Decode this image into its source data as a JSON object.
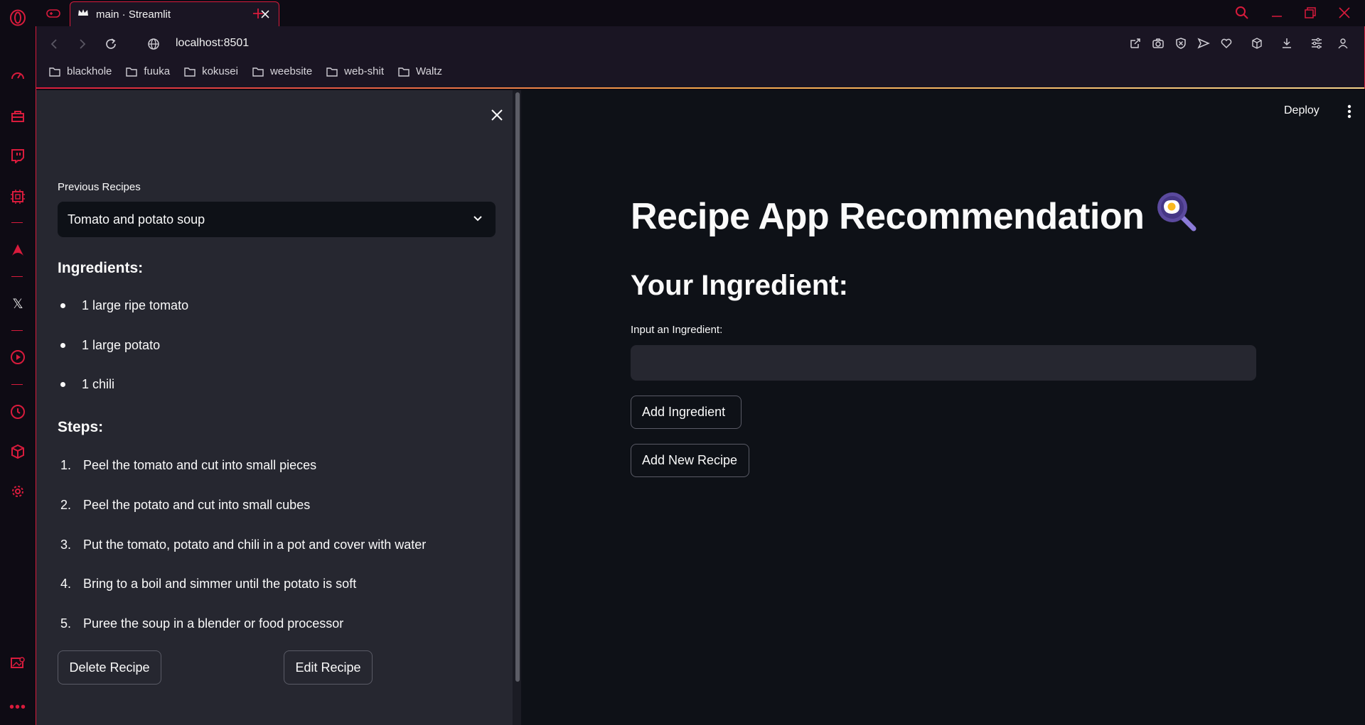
{
  "browser": {
    "tab_title": "main · Streamlit",
    "url": "localhost:8501",
    "bookmarks": [
      "blackhole",
      "fuuka",
      "kokusei",
      "weebsite",
      "web-shit",
      "Waltz"
    ],
    "accent": "#d81b3c"
  },
  "rail_icons": [
    "opera-logo-icon",
    "speed-dial-icon",
    "shopping-bag-icon",
    "twitch-icon",
    "ai-chip-icon",
    "aria-icon",
    "x-twitter-icon",
    "player-icon",
    "history-icon",
    "extensions-cube-icon",
    "settings-gear-icon",
    "pinboard-icon",
    "more-dots-icon"
  ],
  "sidebar": {
    "select_label": "Previous Recipes",
    "selected_recipe": "Tomato and potato soup",
    "ingredients_heading": "Ingredients:",
    "ingredients": [
      "1 large ripe tomato",
      "1 large potato",
      "1 chili"
    ],
    "steps_heading": "Steps:",
    "steps": [
      {
        "num": "1.",
        "text": "Peel the tomato and cut into small pieces"
      },
      {
        "num": "2.",
        "text": "Peel the potato and cut into small cubes"
      },
      {
        "num": "3.",
        "text": "Put the tomato, potato and chili in a pot and cover with water"
      },
      {
        "num": "4.",
        "text": "Bring to a boil and simmer until the potato is soft"
      },
      {
        "num": "5.",
        "text": "Puree the soup in a blender or food processor"
      }
    ],
    "delete_label": "Delete Recipe",
    "edit_label": "Edit Recipe"
  },
  "main": {
    "deploy_label": "Deploy",
    "title": "Recipe App Recommendation",
    "subtitle": "Your Ingredient:",
    "input_label": "Input an Ingredient:",
    "input_value": "",
    "add_ingredient_label": "Add Ingredient",
    "add_recipe_label": "Add New Recipe"
  }
}
